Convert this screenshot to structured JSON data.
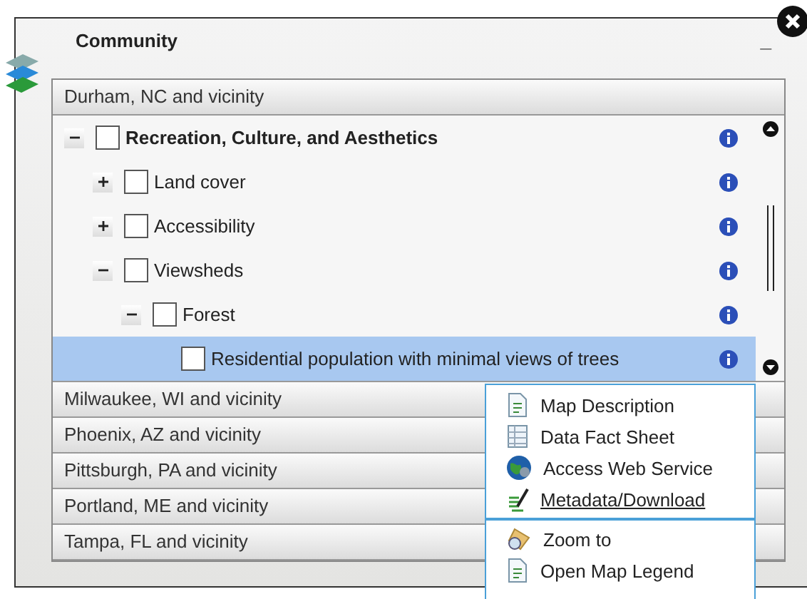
{
  "panel": {
    "title": "Community",
    "minimize": "_"
  },
  "sections": [
    {
      "label": "Durham, NC and vicinity",
      "expanded": true,
      "tree": [
        {
          "label": "Recreation, Culture, and Aesthetics",
          "bold": true,
          "checked": false,
          "expanded": true,
          "selected": false,
          "children": [
            {
              "label": "Land cover",
              "checked": false,
              "expanded": false,
              "selected": false
            },
            {
              "label": "Accessibility",
              "checked": false,
              "expanded": false,
              "selected": false
            },
            {
              "label": "Viewsheds",
              "bold": false,
              "checked": false,
              "expanded": true,
              "selected": false,
              "children": [
                {
                  "label": "Forest",
                  "checked": false,
                  "expanded": true,
                  "selected": false,
                  "children": [
                    {
                      "label": "Residential population with minimal views of trees",
                      "checked": false,
                      "selected": true
                    }
                  ]
                }
              ]
            }
          ]
        }
      ]
    },
    {
      "label": "Milwaukee, WI and vicinity",
      "expanded": false
    },
    {
      "label": "Phoenix, AZ and vicinity",
      "expanded": false
    },
    {
      "label": "Pittsburgh, PA and vicinity",
      "expanded": false
    },
    {
      "label": "Portland, ME and vicinity",
      "expanded": false
    },
    {
      "label": "Tampa, FL and vicinity",
      "expanded": false
    }
  ],
  "context_menu": {
    "groups": [
      [
        {
          "label": "Map Description",
          "kind": "doc",
          "link": false
        },
        {
          "label": "Data Fact Sheet",
          "kind": "sheet",
          "link": false
        },
        {
          "label": "Access Web Service",
          "kind": "globe",
          "link": false
        },
        {
          "label": "Metadata/Download",
          "kind": "edit",
          "link": true
        }
      ],
      [
        {
          "label": "Zoom to",
          "kind": "zoom",
          "link": false
        },
        {
          "label": "Open Map Legend",
          "kind": "doc",
          "link": false
        }
      ]
    ]
  }
}
